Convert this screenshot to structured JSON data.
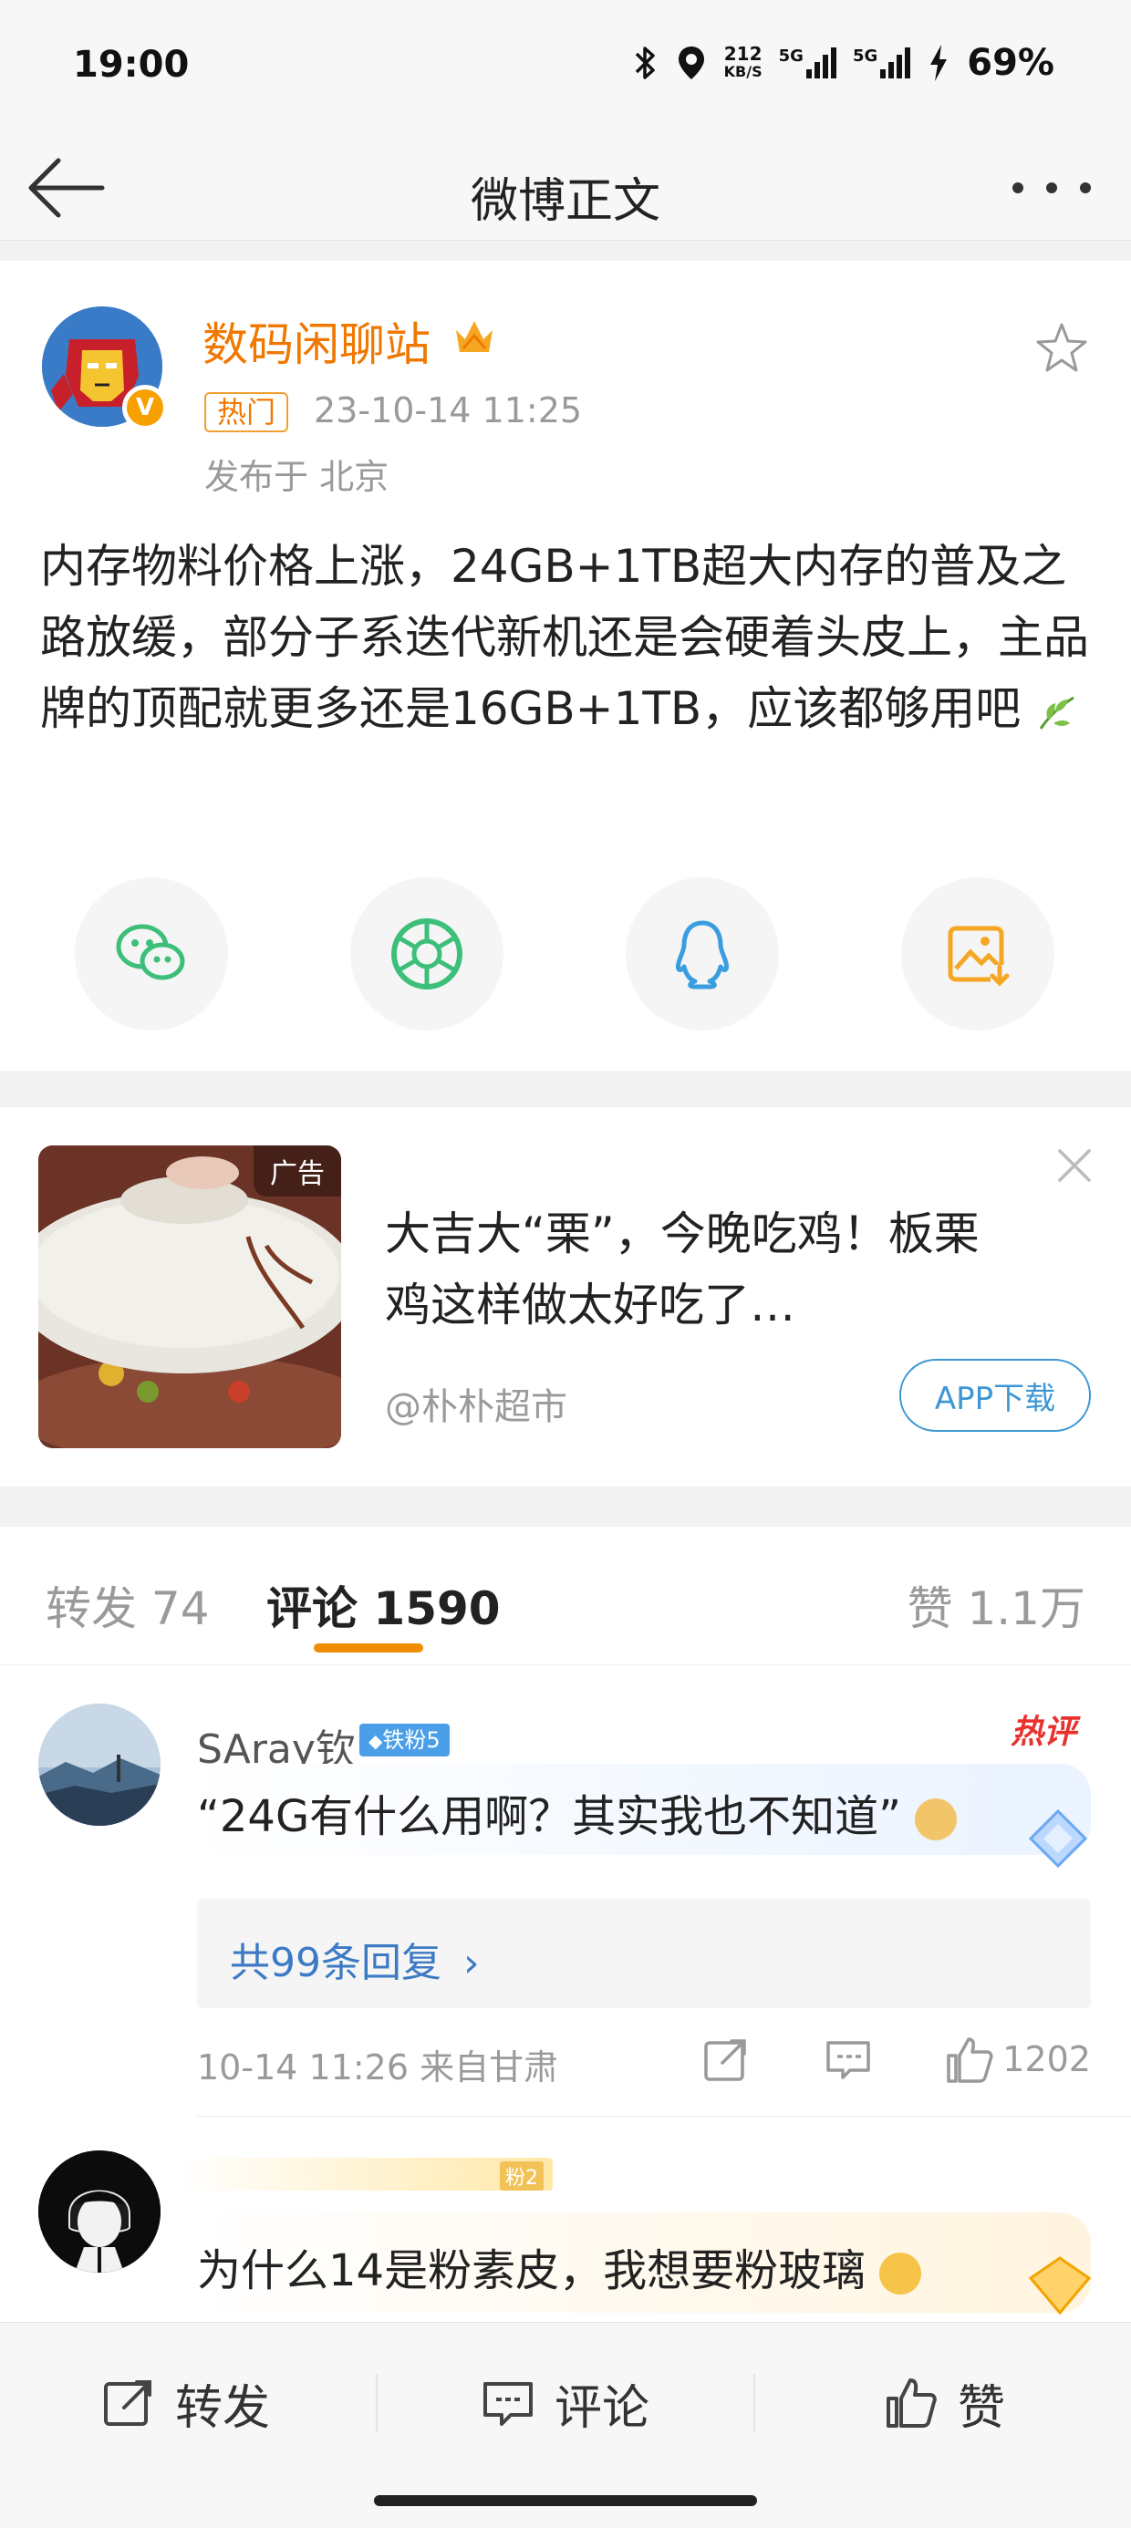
{
  "status_bar": {
    "time": "19:00",
    "net_speed_top": "212",
    "net_speed_unit": "KB/S",
    "sim1_label": "5G",
    "sim2_label": "5G",
    "battery": "69%"
  },
  "nav": {
    "title": "微博正文"
  },
  "post": {
    "author": "数码闲聊站",
    "hot_tag": "热门",
    "time": "23-10-14 11:25",
    "location": "发布于 北京",
    "text": "内存物料价格上涨，24GB+1TB超大内存的普及之路放缓，部分子系迭代新机还是会硬着头皮上，主品牌的顶配就更多还是16GB+1TB，应该都够用吧",
    "verified_mark": "V"
  },
  "share": {
    "icons": [
      "wechat-icon",
      "moments-icon",
      "qq-icon",
      "save-image-icon"
    ],
    "colors": {
      "wechat": "#3dbf7a",
      "moments": "#3dbf7a",
      "qq": "#3a9de0",
      "save": "#f5a623"
    }
  },
  "ad": {
    "label": "广告",
    "title": "大吉大“栗”，今晚吃鸡！板栗鸡这样做太好吃了…",
    "source": "@朴朴超市",
    "button": "APP下载"
  },
  "tabs": {
    "repost": "转发 74",
    "comment": "评论 1590",
    "like": "赞 1.1万"
  },
  "comments": [
    {
      "name": "SAray钦",
      "badge": "铁粉5",
      "hot_label": "热评",
      "text": "“24G有什么用啊？其实我也不知道”",
      "replies": "共99条回复",
      "meta": "10-14 11:26  来自甘肃",
      "likes": "1202"
    },
    {
      "badge": "粉2",
      "text": "为什么14是粉素皮，我想要粉玻璃"
    }
  ],
  "bottom_bar": {
    "repost": "转发",
    "comment": "评论",
    "like": "赞"
  },
  "colors": {
    "accent_orange": "#f07800",
    "link_blue": "#3d7ac4",
    "hot_red": "#e8322e"
  }
}
